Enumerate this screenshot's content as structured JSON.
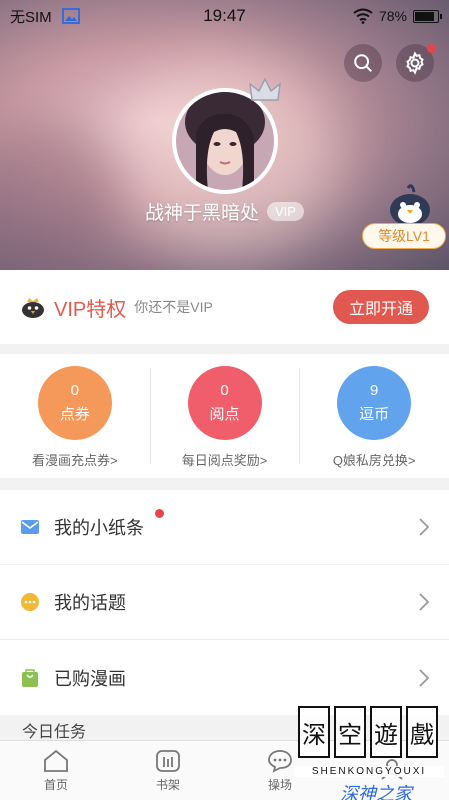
{
  "status_bar": {
    "carrier": "无SIM",
    "time": "19:47",
    "battery": "78%"
  },
  "profile": {
    "username": "战神于黑暗处",
    "vip_tag": "VIP",
    "level": "等级LV1"
  },
  "vip": {
    "title": "VIP特权",
    "subtitle": "你还不是VIP",
    "button": "立即开通"
  },
  "stats": [
    {
      "value": "0",
      "label": "点券",
      "link": "看漫画充点券>",
      "color": "#f5995a"
    },
    {
      "value": "0",
      "label": "阅点",
      "link": "每日阅点奖励>",
      "color": "#ef5e6a"
    },
    {
      "value": "9",
      "label": "逗币",
      "link": "Q娘私房兑换>",
      "color": "#62a3ee"
    }
  ],
  "menu": [
    {
      "label": "我的小纸条",
      "icon": "envelope-icon",
      "color": "#5c9cec"
    },
    {
      "label": "我的话题",
      "icon": "chat-icon",
      "color": "#f1b935"
    },
    {
      "label": "已购漫画",
      "icon": "bag-icon",
      "color": "#8cc152"
    }
  ],
  "today_section": "今日任务",
  "tabs": [
    {
      "label": "首页",
      "icon": "home-icon"
    },
    {
      "label": "书架",
      "icon": "bookshelf-icon"
    },
    {
      "label": "操场",
      "icon": "playground-icon"
    },
    {
      "label": "",
      "icon": "profile-icon"
    }
  ],
  "watermark": {
    "chars": [
      "深",
      "空",
      "遊",
      "戲"
    ],
    "latin": "SHENKONGYOUXI",
    "sub": "深神之家"
  },
  "colors": {
    "accent": "#e0584f",
    "vip_red": "#e05a4e",
    "level_orange": "#e08a2e"
  }
}
